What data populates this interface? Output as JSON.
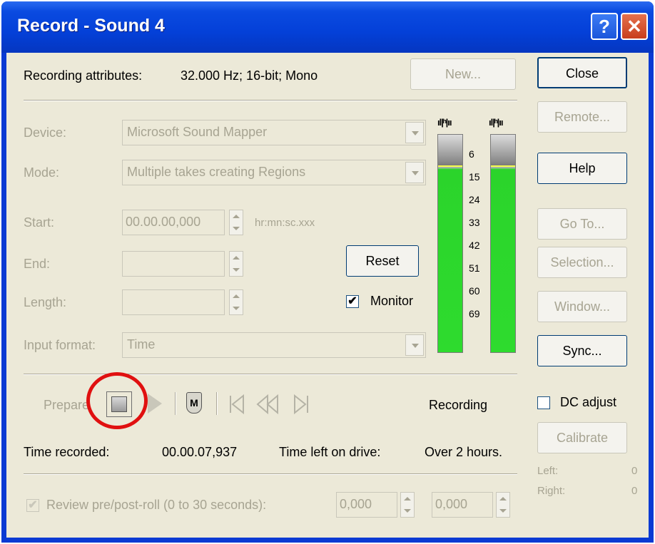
{
  "window": {
    "title": "Record - Sound 4",
    "help_glyph": "?",
    "close_glyph": "✕"
  },
  "attributes": {
    "label": "Recording attributes:",
    "value": "32.000 Hz; 16-bit; Mono",
    "new_button": "New..."
  },
  "buttons": {
    "close": "Close",
    "remote": "Remote...",
    "help": "Help",
    "goto": "Go To...",
    "selection": "Selection...",
    "window": "Window...",
    "sync": "Sync...",
    "calibrate": "Calibrate",
    "reset": "Reset"
  },
  "fields": {
    "device_label": "Device:",
    "device_value": "Microsoft Sound Mapper",
    "mode_label": "Mode:",
    "mode_value": "Multiple takes creating Regions",
    "start_label": "Start:",
    "start_value": "00.00.00,000",
    "start_units": "hr:mn:sc.xxx",
    "end_label": "End:",
    "end_value": "",
    "length_label": "Length:",
    "length_value": "",
    "input_format_label": "Input format:",
    "input_format_value": "Time"
  },
  "monitor": {
    "label": "Monitor",
    "checked": true
  },
  "meters": {
    "peak_left": "ıl|ʰ|ıı",
    "peak_right": "ıl|ʰ|ıı",
    "scale": [
      "6",
      "15",
      "24",
      "33",
      "42",
      "51",
      "60",
      "69"
    ]
  },
  "transport": {
    "prepare": "Prepare",
    "status": "Recording",
    "marker_glyph": "M"
  },
  "dc_adjust": {
    "label": "DC adjust",
    "checked": false
  },
  "levels": {
    "left_label": "Left:",
    "left_value": "0",
    "right_label": "Right:",
    "right_value": "0"
  },
  "time": {
    "recorded_label": "Time recorded:",
    "recorded_value": "00.00.07,937",
    "left_label": "Time left on drive:",
    "left_value": "Over 2 hours."
  },
  "review": {
    "label": "Review pre/post-roll (0 to 30 seconds):",
    "checked": true,
    "pre_value": "0,000",
    "post_value": "0,000"
  },
  "colors": {
    "titlebar": "#0a4ae0",
    "meter_green": "#2edb2e",
    "highlight_circle": "#e01010"
  }
}
